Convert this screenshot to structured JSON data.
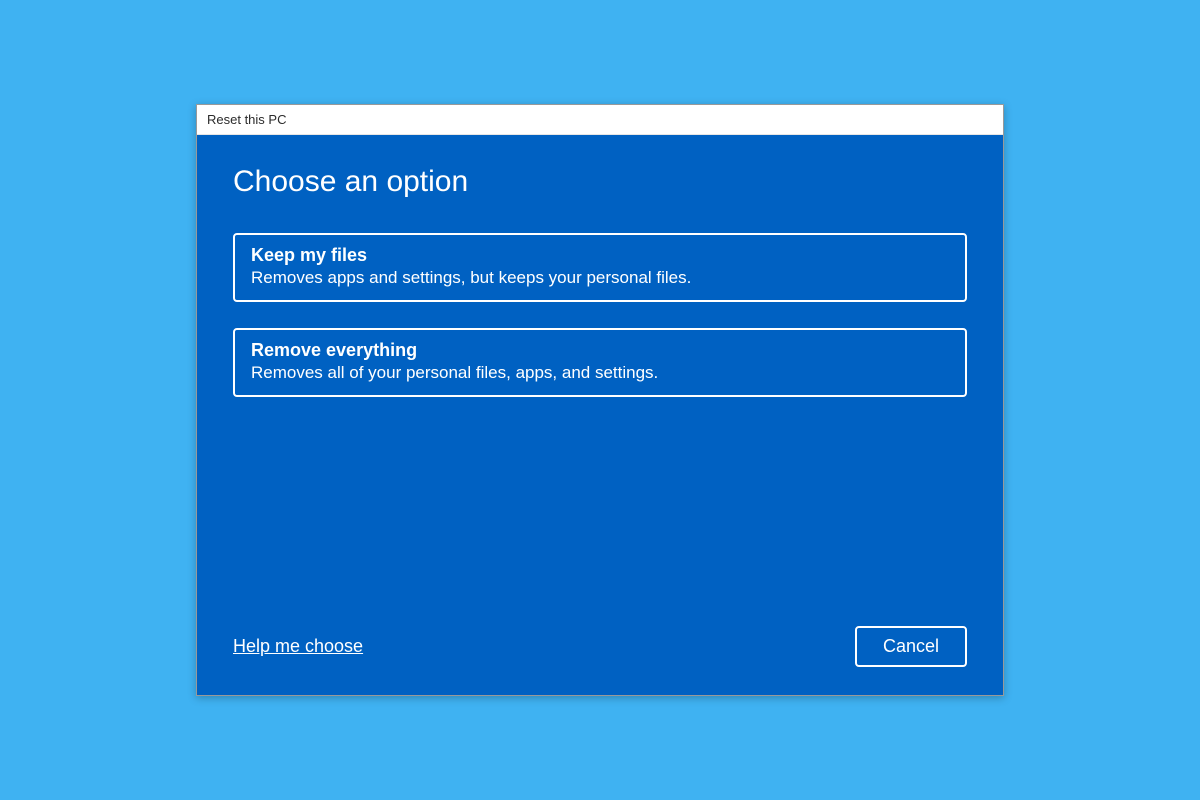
{
  "dialog": {
    "title": "Reset this PC",
    "heading": "Choose an option",
    "options": [
      {
        "title": "Keep my files",
        "description": "Removes apps and settings, but keeps your personal files."
      },
      {
        "title": "Remove everything",
        "description": "Removes all of your personal files, apps, and settings."
      }
    ],
    "help_link": "Help me choose",
    "cancel_label": "Cancel"
  },
  "colors": {
    "background": "#3fb2f2",
    "dialog_body": "#0061c2",
    "text": "#ffffff"
  }
}
